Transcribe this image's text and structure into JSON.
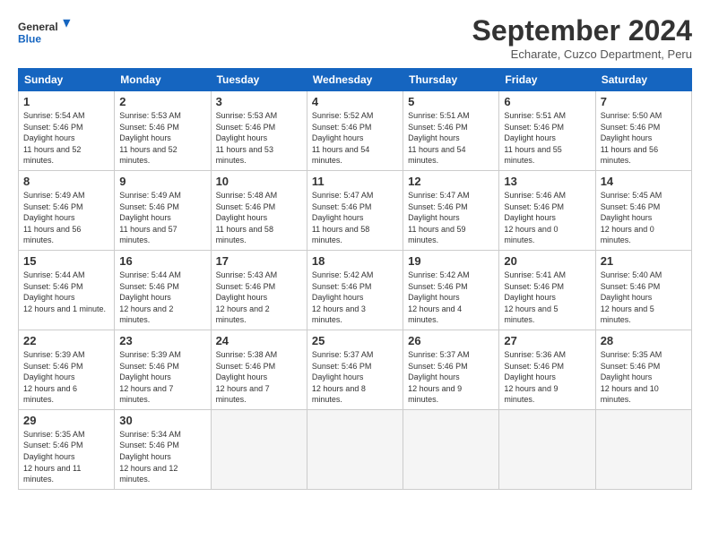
{
  "logo": {
    "line1": "General",
    "line2": "Blue"
  },
  "title": "September 2024",
  "subtitle": "Echarate, Cuzco Department, Peru",
  "weekdays": [
    "Sunday",
    "Monday",
    "Tuesday",
    "Wednesday",
    "Thursday",
    "Friday",
    "Saturday"
  ],
  "weeks": [
    [
      {
        "day": "1",
        "sunrise": "5:54 AM",
        "sunset": "5:46 PM",
        "daylight": "11 hours and 52 minutes."
      },
      {
        "day": "2",
        "sunrise": "5:53 AM",
        "sunset": "5:46 PM",
        "daylight": "11 hours and 52 minutes."
      },
      {
        "day": "3",
        "sunrise": "5:53 AM",
        "sunset": "5:46 PM",
        "daylight": "11 hours and 53 minutes."
      },
      {
        "day": "4",
        "sunrise": "5:52 AM",
        "sunset": "5:46 PM",
        "daylight": "11 hours and 54 minutes."
      },
      {
        "day": "5",
        "sunrise": "5:51 AM",
        "sunset": "5:46 PM",
        "daylight": "11 hours and 54 minutes."
      },
      {
        "day": "6",
        "sunrise": "5:51 AM",
        "sunset": "5:46 PM",
        "daylight": "11 hours and 55 minutes."
      },
      {
        "day": "7",
        "sunrise": "5:50 AM",
        "sunset": "5:46 PM",
        "daylight": "11 hours and 56 minutes."
      }
    ],
    [
      {
        "day": "8",
        "sunrise": "5:49 AM",
        "sunset": "5:46 PM",
        "daylight": "11 hours and 56 minutes."
      },
      {
        "day": "9",
        "sunrise": "5:49 AM",
        "sunset": "5:46 PM",
        "daylight": "11 hours and 57 minutes."
      },
      {
        "day": "10",
        "sunrise": "5:48 AM",
        "sunset": "5:46 PM",
        "daylight": "11 hours and 58 minutes."
      },
      {
        "day": "11",
        "sunrise": "5:47 AM",
        "sunset": "5:46 PM",
        "daylight": "11 hours and 58 minutes."
      },
      {
        "day": "12",
        "sunrise": "5:47 AM",
        "sunset": "5:46 PM",
        "daylight": "11 hours and 59 minutes."
      },
      {
        "day": "13",
        "sunrise": "5:46 AM",
        "sunset": "5:46 PM",
        "daylight": "12 hours and 0 minutes."
      },
      {
        "day": "14",
        "sunrise": "5:45 AM",
        "sunset": "5:46 PM",
        "daylight": "12 hours and 0 minutes."
      }
    ],
    [
      {
        "day": "15",
        "sunrise": "5:44 AM",
        "sunset": "5:46 PM",
        "daylight": "12 hours and 1 minute."
      },
      {
        "day": "16",
        "sunrise": "5:44 AM",
        "sunset": "5:46 PM",
        "daylight": "12 hours and 2 minutes."
      },
      {
        "day": "17",
        "sunrise": "5:43 AM",
        "sunset": "5:46 PM",
        "daylight": "12 hours and 2 minutes."
      },
      {
        "day": "18",
        "sunrise": "5:42 AM",
        "sunset": "5:46 PM",
        "daylight": "12 hours and 3 minutes."
      },
      {
        "day": "19",
        "sunrise": "5:42 AM",
        "sunset": "5:46 PM",
        "daylight": "12 hours and 4 minutes."
      },
      {
        "day": "20",
        "sunrise": "5:41 AM",
        "sunset": "5:46 PM",
        "daylight": "12 hours and 5 minutes."
      },
      {
        "day": "21",
        "sunrise": "5:40 AM",
        "sunset": "5:46 PM",
        "daylight": "12 hours and 5 minutes."
      }
    ],
    [
      {
        "day": "22",
        "sunrise": "5:39 AM",
        "sunset": "5:46 PM",
        "daylight": "12 hours and 6 minutes."
      },
      {
        "day": "23",
        "sunrise": "5:39 AM",
        "sunset": "5:46 PM",
        "daylight": "12 hours and 7 minutes."
      },
      {
        "day": "24",
        "sunrise": "5:38 AM",
        "sunset": "5:46 PM",
        "daylight": "12 hours and 7 minutes."
      },
      {
        "day": "25",
        "sunrise": "5:37 AM",
        "sunset": "5:46 PM",
        "daylight": "12 hours and 8 minutes."
      },
      {
        "day": "26",
        "sunrise": "5:37 AM",
        "sunset": "5:46 PM",
        "daylight": "12 hours and 9 minutes."
      },
      {
        "day": "27",
        "sunrise": "5:36 AM",
        "sunset": "5:46 PM",
        "daylight": "12 hours and 9 minutes."
      },
      {
        "day": "28",
        "sunrise": "5:35 AM",
        "sunset": "5:46 PM",
        "daylight": "12 hours and 10 minutes."
      }
    ],
    [
      {
        "day": "29",
        "sunrise": "5:35 AM",
        "sunset": "5:46 PM",
        "daylight": "12 hours and 11 minutes."
      },
      {
        "day": "30",
        "sunrise": "5:34 AM",
        "sunset": "5:46 PM",
        "daylight": "12 hours and 12 minutes."
      },
      null,
      null,
      null,
      null,
      null
    ]
  ]
}
